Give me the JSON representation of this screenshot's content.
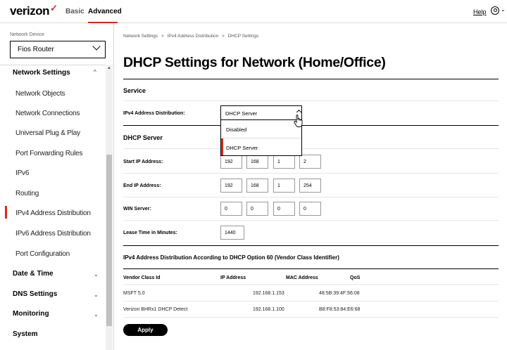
{
  "header": {
    "logo": "verizon",
    "logo_mark": "✓",
    "tabs": [
      {
        "label": "Basic"
      },
      {
        "label": "Advanced"
      }
    ],
    "help": "Help",
    "accent_color": "#d52b1e"
  },
  "sidebar": {
    "device_label": "Network Device",
    "device_value": "Fios Router",
    "sections": [
      {
        "label": "Network Settings",
        "expanded": true,
        "items": [
          {
            "label": "Network Objects"
          },
          {
            "label": "Network Connections"
          },
          {
            "label": "Universal Plug & Play"
          },
          {
            "label": "Port Forwarding Rules"
          },
          {
            "label": "IPv6"
          },
          {
            "label": "Routing"
          },
          {
            "label": "IPv4 Address Distribution",
            "active": true
          },
          {
            "label": "IPv6 Address Distribution"
          },
          {
            "label": "Port Configuration"
          }
        ]
      },
      {
        "label": "Date & Time"
      },
      {
        "label": "DNS Settings"
      },
      {
        "label": "Monitoring"
      },
      {
        "label": "System"
      }
    ]
  },
  "breadcrumb": [
    "Network Settings",
    "IPv4 Address Distribution",
    "DHCP Settings"
  ],
  "breadcrumb_sep": ">",
  "page_title": "DHCP Settings for Network (Home/Office)",
  "service": {
    "heading": "Service",
    "dist_label": "IPv4 Address Distribution:",
    "dist_value": "DHCP Server",
    "options": [
      "Disabled",
      "DHCP Server"
    ]
  },
  "dhcp_server": {
    "heading": "DHCP Server",
    "start_label": "Start IP Address:",
    "start_ip": [
      "192",
      "168",
      "1",
      "2"
    ],
    "end_label": "End IP Address:",
    "end_ip": [
      "192",
      "168",
      "1",
      "254"
    ],
    "win_label": "WIN Server:",
    "win_ip": [
      "0",
      "0",
      "0",
      "0"
    ],
    "lease_label": "Lease Time in Minutes:",
    "lease_value": "1440"
  },
  "vendor": {
    "heading": "IPv4 Address Distribution According to DHCP Option 60 (Vendor Class Identifier)",
    "columns": [
      "Vendor Class Id",
      "IP Address",
      "MAC Address",
      "QoS"
    ],
    "rows": [
      [
        "MSFT 5.0",
        "192.168.1.153",
        "48:5B:39:4F:56:08",
        ""
      ],
      [
        "Verizon BHRx1 DHCP Detect",
        "192.168.1.100",
        "B8:F8:53:84:E6:68",
        ""
      ]
    ]
  },
  "apply_label": "Apply"
}
